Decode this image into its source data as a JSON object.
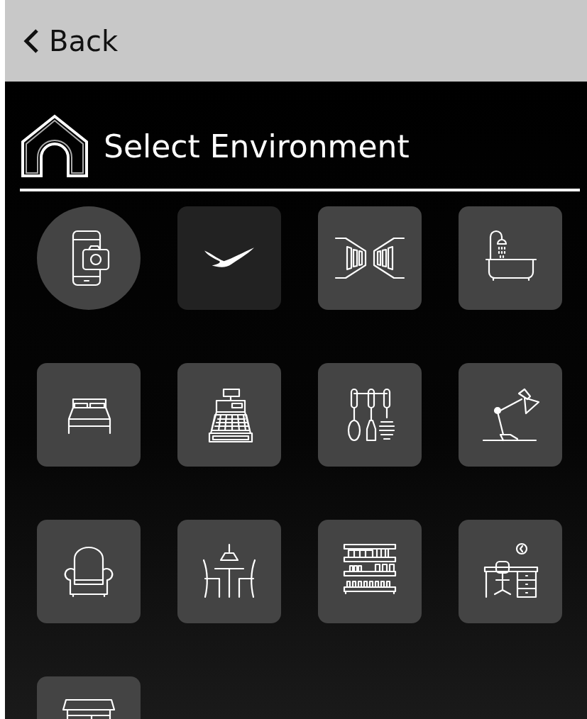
{
  "header": {
    "back_label": "Back"
  },
  "title": "Select Environment",
  "tiles": [
    {
      "kind": "round",
      "selected": false
    },
    {
      "kind": "square",
      "selected": true
    },
    {
      "kind": "square",
      "selected": false
    },
    {
      "kind": "square",
      "selected": false
    },
    {
      "kind": "square",
      "selected": false
    },
    {
      "kind": "square",
      "selected": false
    },
    {
      "kind": "square",
      "selected": false
    },
    {
      "kind": "square",
      "selected": false
    },
    {
      "kind": "square",
      "selected": false
    },
    {
      "kind": "square",
      "selected": false
    },
    {
      "kind": "square",
      "selected": false
    },
    {
      "kind": "square",
      "selected": false
    },
    {
      "kind": "square",
      "selected": false
    }
  ]
}
